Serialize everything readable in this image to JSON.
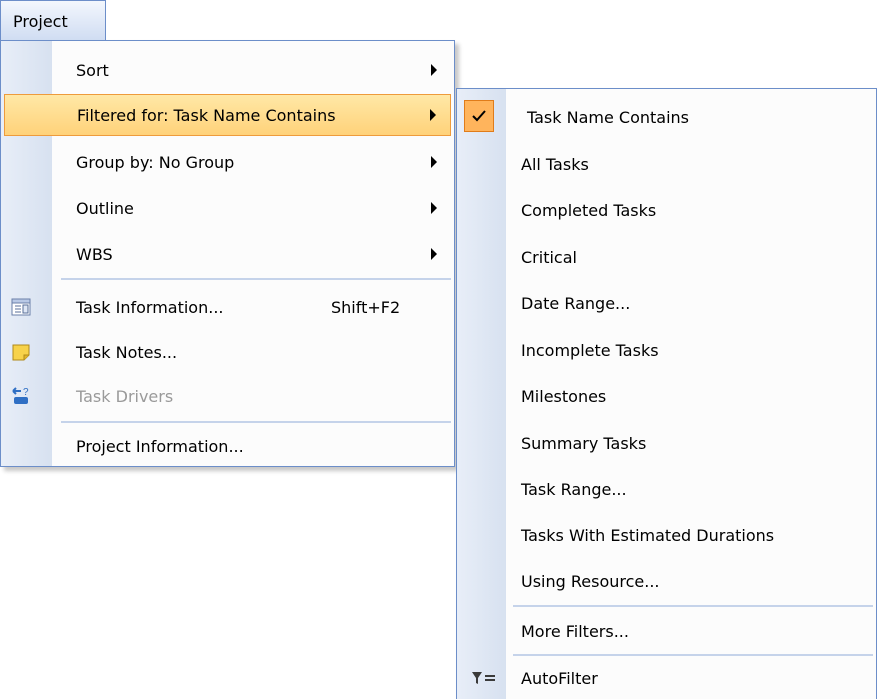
{
  "menubar": {
    "project_label": "Project"
  },
  "project_menu": {
    "sort_label": "Sort",
    "filtered_for_label": "Filtered for:  Task Name  Contains",
    "group_by_label": "Group by: No Group",
    "outline_label": "Outline",
    "wbs_label": "WBS",
    "task_information_label": "Task Information...",
    "task_information_shortcut": "Shift+F2",
    "task_notes_label": "Task Notes...",
    "task_drivers_label": "Task Drivers",
    "project_information_label": "Project Information..."
  },
  "filter_submenu": {
    "items": [
      "Task Name  Contains",
      "All Tasks",
      "Completed Tasks",
      "Critical",
      "Date Range...",
      "Incomplete Tasks",
      "Milestones",
      "Summary Tasks",
      "Task Range...",
      "Tasks With Estimated Durations",
      "Using Resource..."
    ],
    "more_filters_label": "More Filters...",
    "autofilter_label": "AutoFilter"
  },
  "colors": {
    "highlight": "#ffd27a",
    "highlight_border": "#ee9b3c",
    "menu_border": "#6c8ec9",
    "gutter": "#dde6f3"
  }
}
